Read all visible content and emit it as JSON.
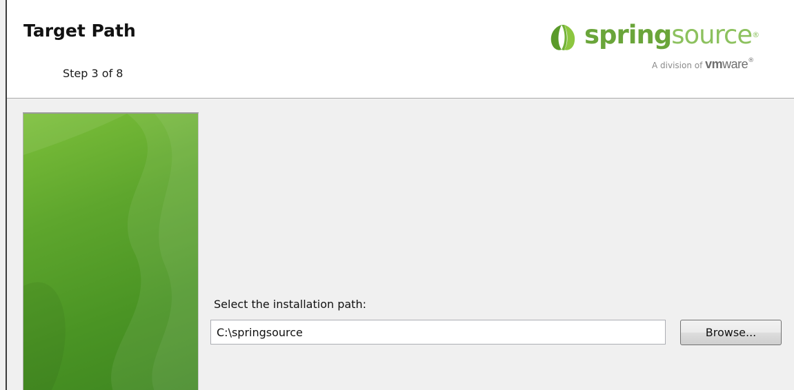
{
  "header": {
    "title": "Target Path",
    "step": "Step 3 of 8"
  },
  "logo": {
    "word_bold": "spring",
    "word_light": "source",
    "registered": "®",
    "division_prefix": "A division of",
    "division_vm": "vm",
    "division_ware": "ware",
    "division_registered": "®",
    "colors": {
      "leaf_dark": "#5a9a2a",
      "leaf_light": "#8cc63f"
    }
  },
  "main": {
    "path_label": "Select the installation path:",
    "path_value": "C:\\springsource",
    "browse_label": "Browse..."
  },
  "colors": {
    "panel_green": "#5ea62d"
  }
}
